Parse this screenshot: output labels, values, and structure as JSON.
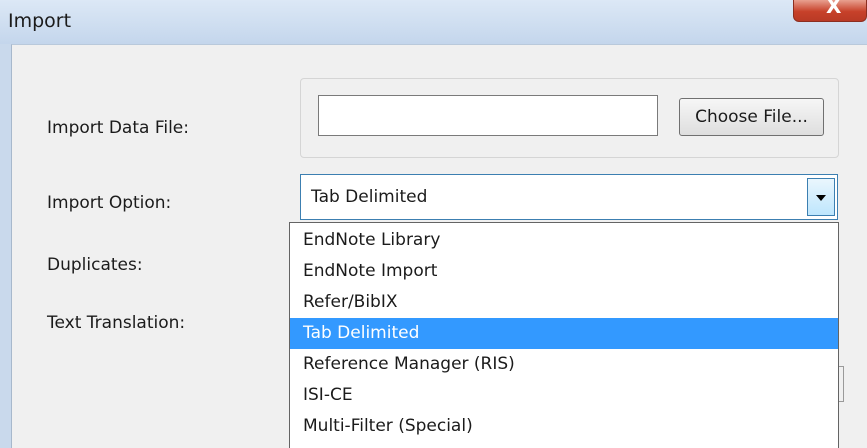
{
  "window": {
    "title": "Import",
    "close_label": "X"
  },
  "form": {
    "import_data_file_label": "Import Data File:",
    "import_data_file_value": "",
    "choose_file_label": "Choose File...",
    "import_option_label": "Import Option:",
    "import_option_value": "Tab Delimited",
    "duplicates_label": "Duplicates:",
    "text_translation_label": "Text Translation:"
  },
  "dropdown": {
    "selected": "Tab Delimited",
    "options": [
      "EndNote Library",
      "EndNote Import",
      "Refer/BibIX",
      "Tab Delimited",
      "Reference Manager (RIS)",
      "ISI-CE",
      "Multi-Filter (Special)"
    ]
  },
  "colors": {
    "highlight": "#3399ff",
    "close_button": "#c7412a",
    "title_bar": "#c9d9ec"
  }
}
